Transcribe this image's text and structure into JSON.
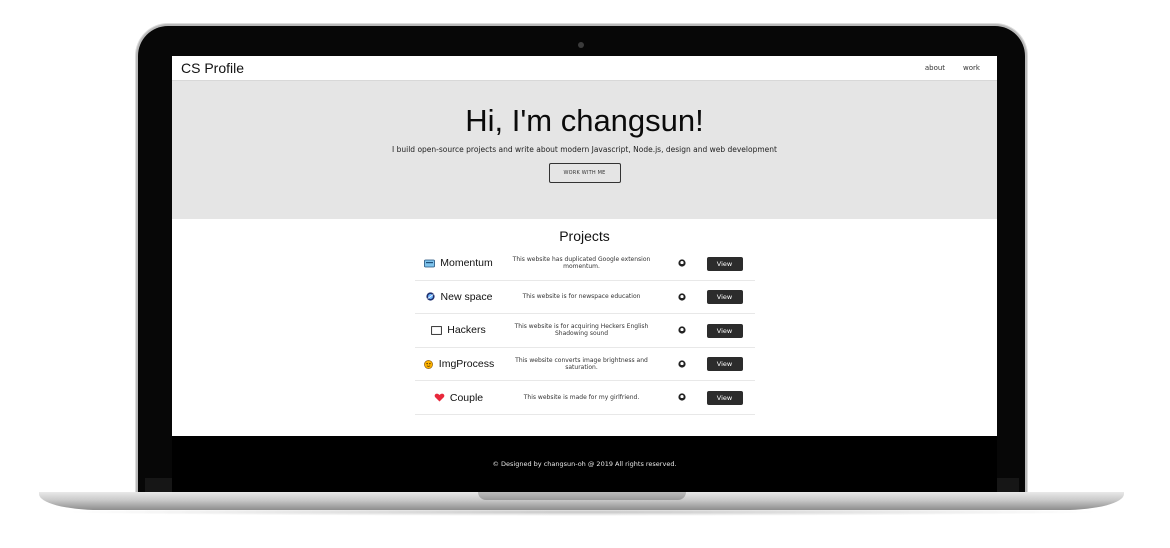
{
  "site": {
    "brand": "CS Profile",
    "nav": [
      "about",
      "work"
    ]
  },
  "hero": {
    "title": "Hi, I'm changsun!",
    "subtitle": "I build open-source projects and write about modern Javascript, Node.js, design and web development",
    "button": "WORK WITH ME"
  },
  "projects": {
    "heading": "Projects",
    "items": [
      {
        "name": "Momentum",
        "icon": "momentum-icon",
        "description": "This website has duplicated Google extension momentum.",
        "view": "View"
      },
      {
        "name": "New space",
        "icon": "newspace-icon",
        "description": "This website is for newspace education",
        "view": "View"
      },
      {
        "name": "Hackers",
        "icon": "hackers-icon",
        "description": "This website is for acquiring Heckers English Shadowing sound",
        "view": "View"
      },
      {
        "name": "ImgProcess",
        "icon": "imgprocess-icon",
        "description": "This website converts image brightness and saturation.",
        "view": "View"
      },
      {
        "name": "Couple",
        "icon": "couple-heart-icon",
        "description": "This website is made for my girlfriend.",
        "view": "View"
      }
    ]
  },
  "footer": {
    "text": "© Designed by changsun-oh @ 2019 All rights reserved."
  },
  "colors": {
    "hero_bg": "#e5e5e5",
    "button_dark": "#2c2c2c",
    "laptop_frame": "#070707"
  }
}
